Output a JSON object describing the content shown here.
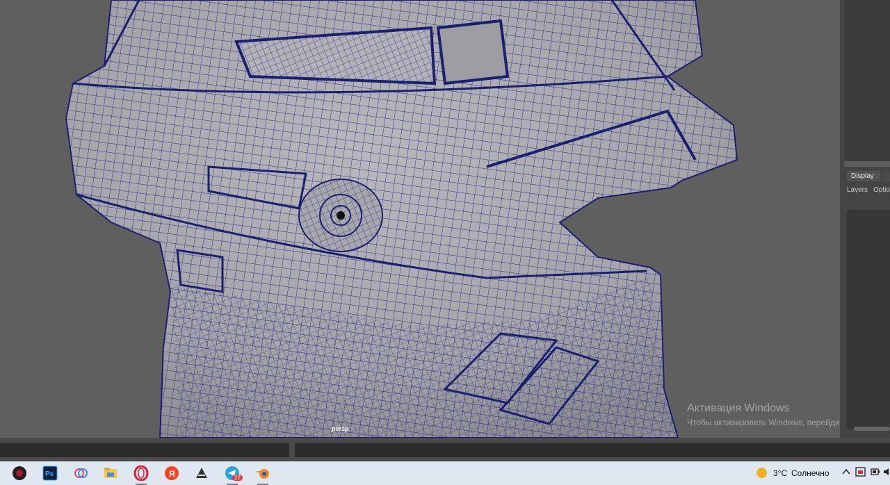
{
  "viewport": {
    "camera_label": "persp",
    "model_icon": "helmet-wireframe-model"
  },
  "watermark": {
    "title": "Активация Windows",
    "subtitle": "Чтобы активировать Windows, перейдите в раздел"
  },
  "side_panel": {
    "tab_label": "Display",
    "menu_items": [
      "Layers",
      "Options"
    ]
  },
  "taskbar": {
    "apps": [
      {
        "name": "app-dark-red-icon",
        "active": false
      },
      {
        "name": "photoshop-icon",
        "active": false
      },
      {
        "name": "paint-3d-icon",
        "active": false
      },
      {
        "name": "file-explorer-icon",
        "active": false
      },
      {
        "name": "opera-icon",
        "active": true
      },
      {
        "name": "yandex-browser-icon",
        "active": false
      },
      {
        "name": "zbrush-icon",
        "active": false
      },
      {
        "name": "telegram-icon",
        "active": true,
        "badge": "22"
      },
      {
        "name": "blender-icon",
        "active": true
      }
    ],
    "weather": {
      "temperature": "3°C",
      "condition": "Солнечно"
    }
  }
}
